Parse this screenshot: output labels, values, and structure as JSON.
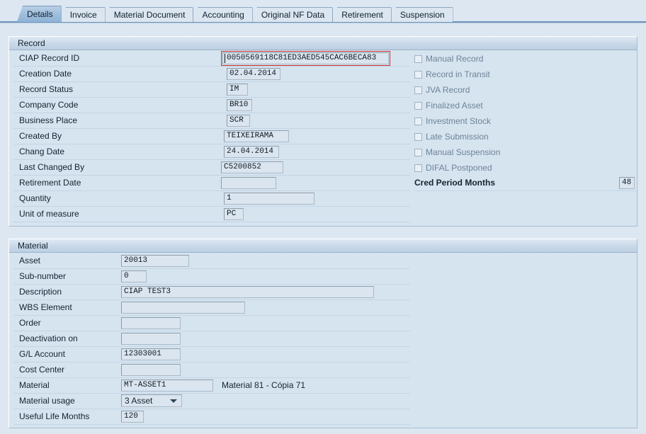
{
  "tabs": [
    {
      "label": "Details",
      "active": true
    },
    {
      "label": "Invoice",
      "active": false
    },
    {
      "label": "Material Document",
      "active": false
    },
    {
      "label": "Accounting",
      "active": false
    },
    {
      "label": "Original NF Data",
      "active": false
    },
    {
      "label": "Retirement",
      "active": false
    },
    {
      "label": "Suspension",
      "active": false
    }
  ],
  "record": {
    "header": "Record",
    "fields": [
      {
        "label": "CIAP Record ID",
        "value": "0050569118C81ED3AED545CAC6BECA83"
      },
      {
        "label": "Creation Date",
        "value": "02.04.2014"
      },
      {
        "label": "Record Status",
        "value": "IM"
      },
      {
        "label": "Company Code",
        "value": "BR10"
      },
      {
        "label": "Business Place",
        "value": "SCR"
      },
      {
        "label": "Created By",
        "value": "TEIXEIRAMA"
      },
      {
        "label": "Chang Date",
        "value": "24.04.2014"
      },
      {
        "label": "Last Changed By",
        "value": "C5200852"
      },
      {
        "label": "Retirement Date",
        "value": ""
      },
      {
        "label": "Quantity",
        "value": "1"
      },
      {
        "label": "Unit of measure",
        "value": "PC"
      }
    ],
    "checkboxes": [
      {
        "label": "Manual Record",
        "checked": false
      },
      {
        "label": "Record in Transit",
        "checked": false
      },
      {
        "label": "JVA Record",
        "checked": false
      },
      {
        "label": "Finalized Asset",
        "checked": false
      },
      {
        "label": "Investment Stock",
        "checked": false
      },
      {
        "label": "Late Submission",
        "checked": false
      },
      {
        "label": "Manual Suspension",
        "checked": false
      },
      {
        "label": "DIFAL Postponed",
        "checked": false
      }
    ],
    "cred_period": {
      "label": "Cred Period Months",
      "value": "48"
    }
  },
  "material": {
    "header": "Material",
    "fields": [
      {
        "label": "Asset",
        "value": "20013"
      },
      {
        "label": "Sub-number",
        "value": "0"
      },
      {
        "label": "Description",
        "value": "CIAP TEST3"
      },
      {
        "label": "WBS Element",
        "value": ""
      },
      {
        "label": "Order",
        "value": ""
      },
      {
        "label": "Deactivation on",
        "value": ""
      },
      {
        "label": "G/L Account",
        "value": "12303001"
      },
      {
        "label": "Cost Center",
        "value": ""
      },
      {
        "label": "Material",
        "value": "MT-ASSET1"
      },
      {
        "label": "Useful Life Months",
        "value": "120"
      }
    ],
    "material_description": "Material 81 - Cópia 71",
    "material_usage": {
      "label": "Material usage",
      "value": "3 Asset",
      "icon": "chevron-down-icon"
    }
  },
  "colors": {
    "panel_bg": "#d6e4f0",
    "field_bg": "#dbe5ef",
    "focus_red": "#d0322e",
    "accent": "#6f93b8",
    "disabled_text": "#6e8396"
  }
}
